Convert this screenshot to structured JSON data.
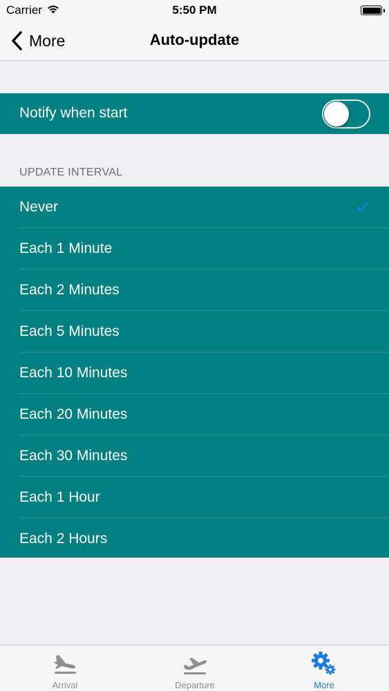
{
  "status_bar": {
    "carrier": "Carrier",
    "time": "5:50 PM",
    "wifi_icon": "wifi-icon",
    "battery_icon": "battery-icon"
  },
  "nav": {
    "back_label": "More",
    "back_icon": "chevron-left-icon",
    "title": "Auto-update"
  },
  "notify": {
    "label": "Notify when start",
    "enabled": false
  },
  "update_interval": {
    "header": "UPDATE INTERVAL",
    "selected": "Never",
    "options": [
      {
        "label": "Never",
        "checked": true
      },
      {
        "label": "Each 1 Minute",
        "checked": false
      },
      {
        "label": "Each 2 Minutes",
        "checked": false
      },
      {
        "label": "Each 5 Minutes",
        "checked": false
      },
      {
        "label": "Each 10 Minutes",
        "checked": false
      },
      {
        "label": "Each 20 Minutes",
        "checked": false
      },
      {
        "label": "Each 30 Minutes",
        "checked": false
      },
      {
        "label": "Each 1 Hour",
        "checked": false
      },
      {
        "label": "Each 2 Hours",
        "checked": false
      }
    ]
  },
  "tabs": [
    {
      "label": "Arrival",
      "icon": "airplane-arrival-icon",
      "active": false
    },
    {
      "label": "Departure",
      "icon": "airplane-departure-icon",
      "active": false
    },
    {
      "label": "More",
      "icon": "gears-icon",
      "active": true
    }
  ],
  "colors": {
    "teal": "#008080",
    "accent": "#1a7be0",
    "inactive_tab": "#929292",
    "background": "#efeff4"
  }
}
